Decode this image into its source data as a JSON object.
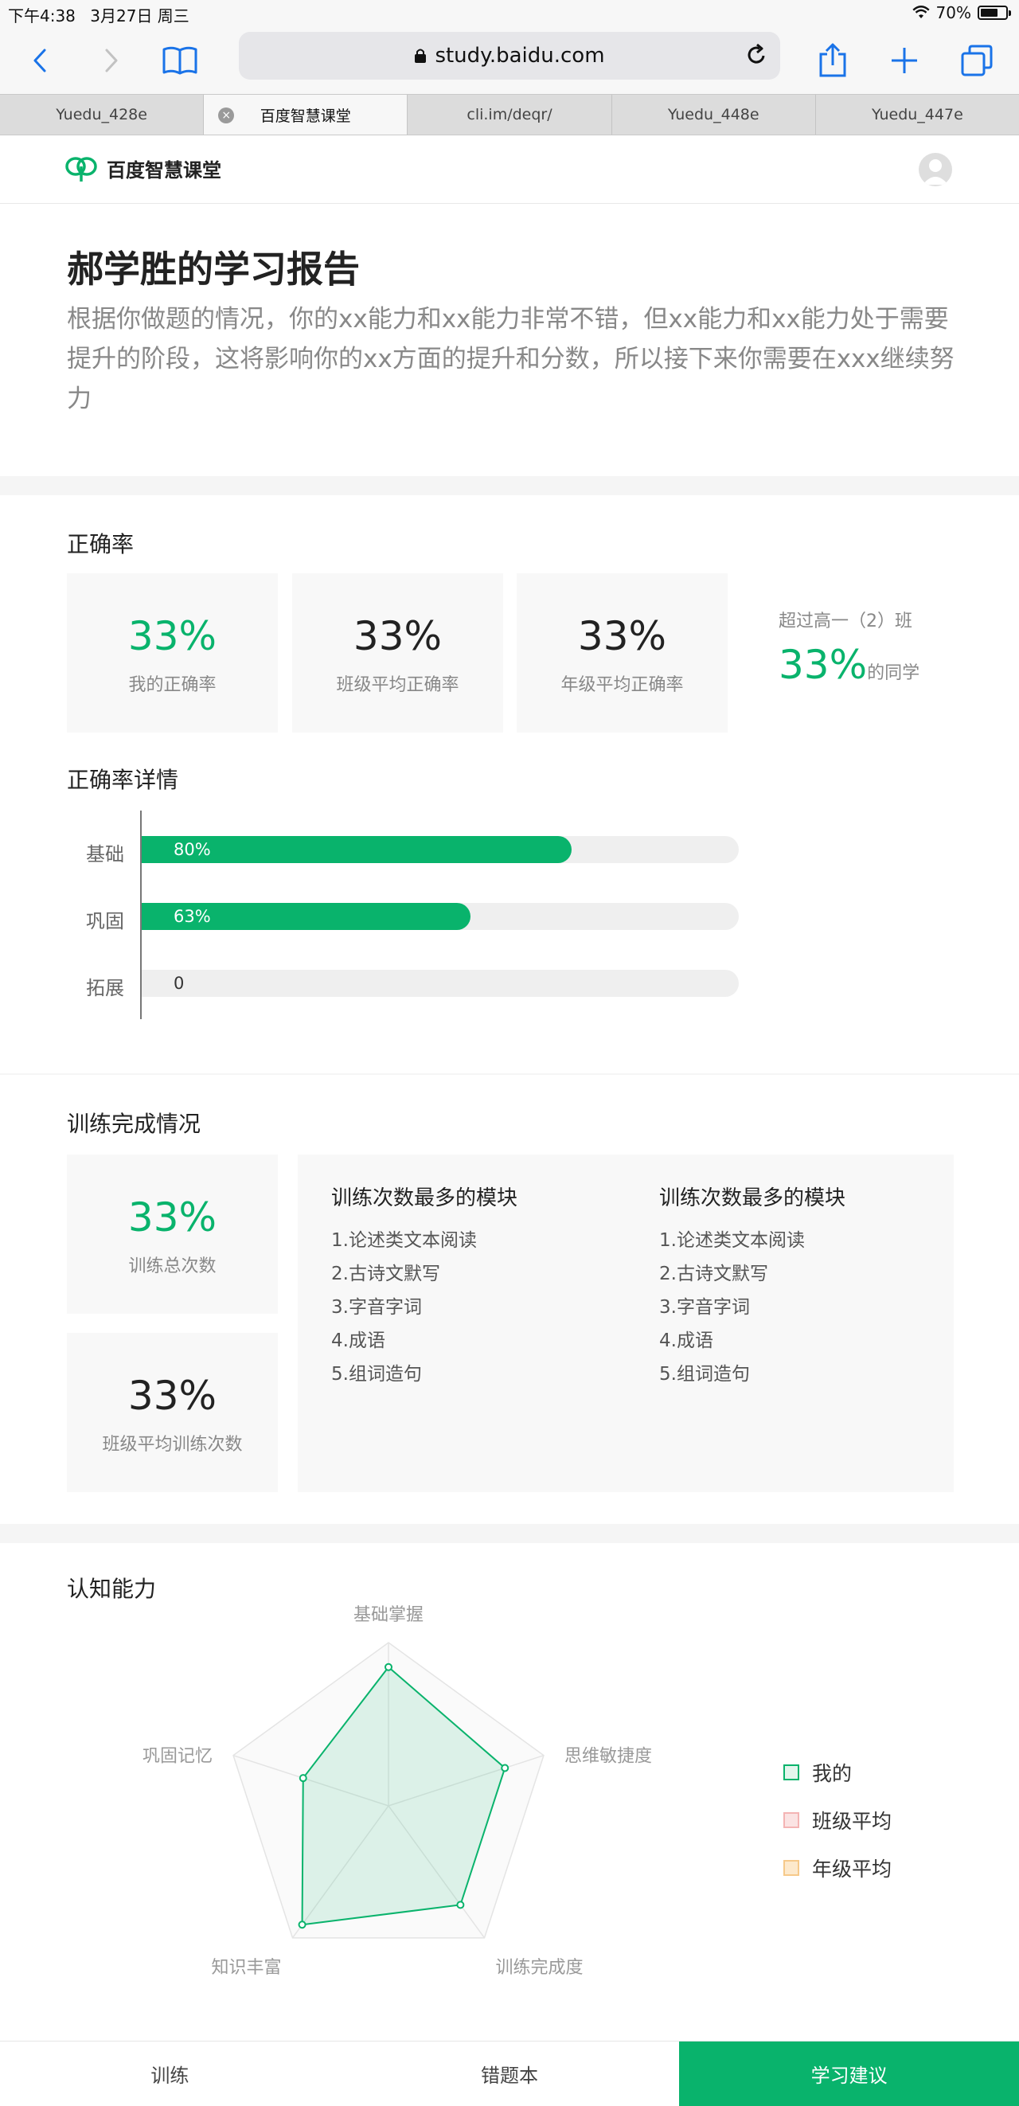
{
  "status_bar": {
    "time": "下午4:38",
    "date": "3月27日 周三",
    "battery": "70%",
    "battery_level": 0.7
  },
  "browser": {
    "url": "study.baidu.com",
    "tabs": [
      {
        "label": "Yuedu_428e",
        "active": false
      },
      {
        "label": "百度智慧课堂",
        "active": true
      },
      {
        "label": "cli.im/deqr/",
        "active": false
      },
      {
        "label": "Yuedu_448e",
        "active": false
      },
      {
        "label": "Yuedu_447e",
        "active": false
      }
    ]
  },
  "site": {
    "brand": "百度智慧课堂"
  },
  "report": {
    "title": "郝学胜的学习报告",
    "description": "根据你做题的情况，你的xx能力和xx能力非常不错，但xx能力和xx能力处于需要提升的阶段，这将影响你的xx方面的提升和分数，所以接下来你需要在xxx继续努力"
  },
  "accuracy": {
    "title": "正确率",
    "stats": [
      {
        "value": "33%",
        "label": "我的正确率"
      },
      {
        "value": "33%",
        "label": "班级平均正确率"
      },
      {
        "value": "33%",
        "label": "年级平均正确率"
      }
    ],
    "exceed_prefix": "超过高一（2）班",
    "exceed_value": "33%",
    "exceed_suffix": "的同学"
  },
  "accuracy_detail": {
    "title": "正确率详情",
    "bars": [
      {
        "label": "基础",
        "value_text": "80%",
        "fill": 0.72
      },
      {
        "label": "巩固",
        "value_text": "63%",
        "fill": 0.55
      },
      {
        "label": "拓展",
        "value_text": "0",
        "fill": 0
      }
    ]
  },
  "training": {
    "title": "训练完成情况",
    "stats": [
      {
        "value": "33%",
        "label": "训练总次数"
      },
      {
        "value": "33%",
        "label": "班级平均训练次数"
      }
    ],
    "columns": [
      {
        "heading": "训练次数最多的模块",
        "items": [
          "1.论述类文本阅读",
          "2.古诗文默写",
          "3.字音字词",
          "4.成语",
          "5.组词造句"
        ]
      },
      {
        "heading": "训练次数最多的模块",
        "items": [
          "1.论述类文本阅读",
          "2.古诗文默写",
          "3.字音字词",
          "4.成语",
          "5.组词造句"
        ]
      }
    ]
  },
  "cognitive": {
    "title": "认知能力",
    "legend": [
      {
        "label": "我的",
        "border": "#09b36c",
        "bg": "#e3f6ed"
      },
      {
        "label": "班级平均",
        "border": "#f4b4b4",
        "bg": "#fbe3e3"
      },
      {
        "label": "年级平均",
        "border": "#f6c98a",
        "bg": "#fde9cc"
      }
    ]
  },
  "chart_data": {
    "type": "radar",
    "axes": [
      "基础掌握",
      "思维敏捷度",
      "训练完成度",
      "知识丰富",
      "巩固记忆"
    ],
    "max": 1,
    "levels": 5,
    "series": [
      {
        "name": "我的",
        "values": [
          0.85,
          0.75,
          0.75,
          0.9,
          0.55
        ]
      }
    ]
  },
  "bottom_nav": [
    {
      "label": "训练",
      "active": false
    },
    {
      "label": "错题本",
      "active": false
    },
    {
      "label": "学习建议",
      "active": true
    }
  ],
  "colors": {
    "brand_green": "#09b36c"
  }
}
